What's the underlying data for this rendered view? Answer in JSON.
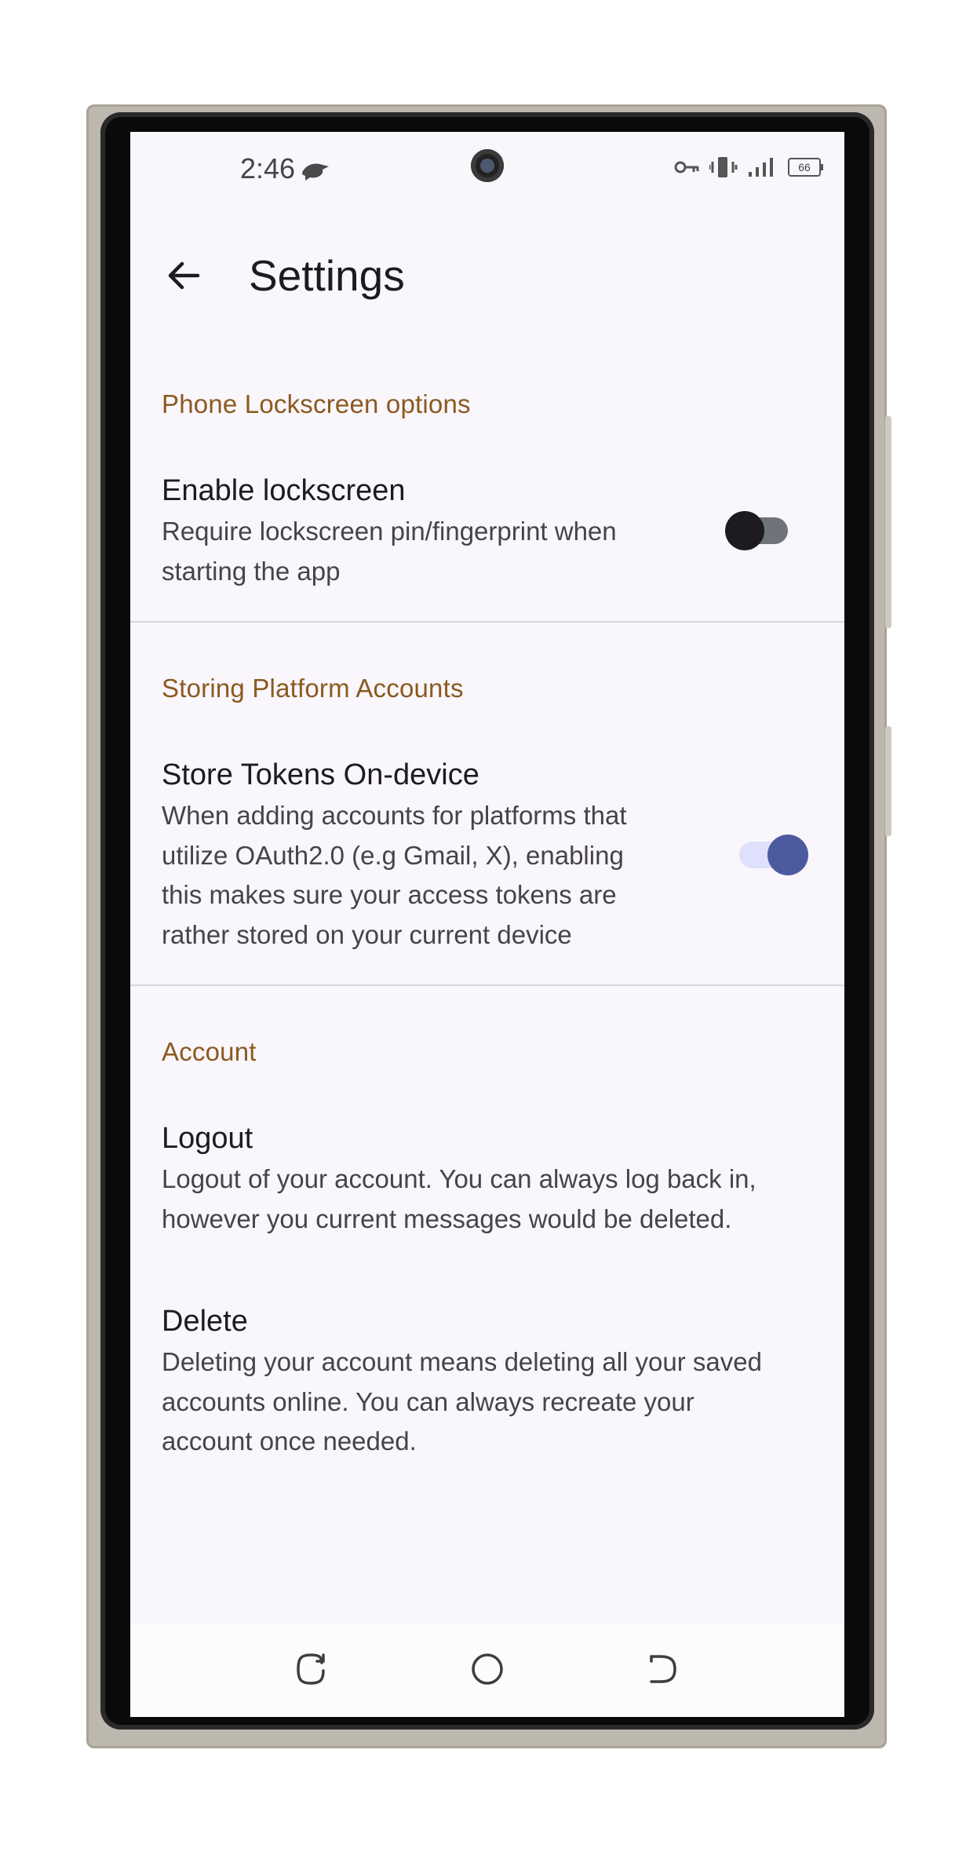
{
  "status_bar": {
    "time": "2:46",
    "battery_level": "66",
    "icons": [
      "notification-app-icon",
      "vpn-key-icon",
      "vibrate-icon",
      "signal-icon",
      "battery-icon"
    ]
  },
  "app_bar": {
    "title": "Settings",
    "back_icon": "arrow-back-icon"
  },
  "sections": {
    "lockscreen": {
      "header": "Phone Lockscreen options",
      "title": "Enable lockscreen",
      "summary_line1": "Require lockscreen pin/fingerprint when",
      "summary_line2": "starting the app",
      "enabled": false
    },
    "platform_accounts": {
      "header": "Storing Platform Accounts",
      "title": "Store Tokens On-device",
      "summary_line1": "When adding accounts for platforms that",
      "summary_line2": "utilize OAuth2.0 (e.g Gmail, X), enabling",
      "summary_line3": "this makes sure your access tokens are",
      "summary_line4": "rather stored on your current device",
      "enabled": true
    },
    "account": {
      "header": "Account",
      "logout_title": "Logout",
      "logout_summary_line1": "Logout of your account. You can always log back in,",
      "logout_summary_line2": "however you current messages would be deleted.",
      "delete_title": "Delete",
      "delete_summary_line1": "Deleting your account means deleting all your saved",
      "delete_summary_line2": "accounts online. You can always recreate your",
      "delete_summary_line3": "account once needed."
    }
  },
  "colors": {
    "section_header": "#8b5a1e",
    "switch_on_thumb": "#4e5aa0",
    "switch_on_track": "#dfe0fb",
    "switch_off_thumb": "#1d1b20",
    "switch_off_track": "#6f747a",
    "background": "#f9f6fc"
  },
  "nav_bar": {
    "buttons": [
      "recents-icon",
      "home-icon",
      "back-gesture-icon"
    ]
  }
}
